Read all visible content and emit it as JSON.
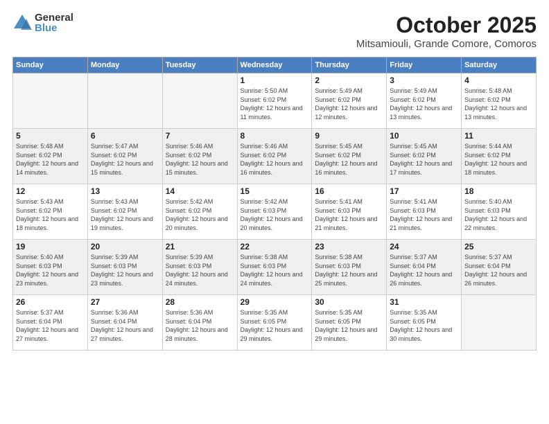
{
  "logo": {
    "general": "General",
    "blue": "Blue"
  },
  "title": "October 2025",
  "subtitle": "Mitsamiouli, Grande Comore, Comoros",
  "days_of_week": [
    "Sunday",
    "Monday",
    "Tuesday",
    "Wednesday",
    "Thursday",
    "Friday",
    "Saturday"
  ],
  "weeks": [
    [
      {
        "day": "",
        "info": ""
      },
      {
        "day": "",
        "info": ""
      },
      {
        "day": "",
        "info": ""
      },
      {
        "day": "1",
        "info": "Sunrise: 5:50 AM\nSunset: 6:02 PM\nDaylight: 12 hours and 11 minutes."
      },
      {
        "day": "2",
        "info": "Sunrise: 5:49 AM\nSunset: 6:02 PM\nDaylight: 12 hours and 12 minutes."
      },
      {
        "day": "3",
        "info": "Sunrise: 5:49 AM\nSunset: 6:02 PM\nDaylight: 12 hours and 13 minutes."
      },
      {
        "day": "4",
        "info": "Sunrise: 5:48 AM\nSunset: 6:02 PM\nDaylight: 12 hours and 13 minutes."
      }
    ],
    [
      {
        "day": "5",
        "info": "Sunrise: 5:48 AM\nSunset: 6:02 PM\nDaylight: 12 hours and 14 minutes."
      },
      {
        "day": "6",
        "info": "Sunrise: 5:47 AM\nSunset: 6:02 PM\nDaylight: 12 hours and 15 minutes."
      },
      {
        "day": "7",
        "info": "Sunrise: 5:46 AM\nSunset: 6:02 PM\nDaylight: 12 hours and 15 minutes."
      },
      {
        "day": "8",
        "info": "Sunrise: 5:46 AM\nSunset: 6:02 PM\nDaylight: 12 hours and 16 minutes."
      },
      {
        "day": "9",
        "info": "Sunrise: 5:45 AM\nSunset: 6:02 PM\nDaylight: 12 hours and 16 minutes."
      },
      {
        "day": "10",
        "info": "Sunrise: 5:45 AM\nSunset: 6:02 PM\nDaylight: 12 hours and 17 minutes."
      },
      {
        "day": "11",
        "info": "Sunrise: 5:44 AM\nSunset: 6:02 PM\nDaylight: 12 hours and 18 minutes."
      }
    ],
    [
      {
        "day": "12",
        "info": "Sunrise: 5:43 AM\nSunset: 6:02 PM\nDaylight: 12 hours and 18 minutes."
      },
      {
        "day": "13",
        "info": "Sunrise: 5:43 AM\nSunset: 6:02 PM\nDaylight: 12 hours and 19 minutes."
      },
      {
        "day": "14",
        "info": "Sunrise: 5:42 AM\nSunset: 6:02 PM\nDaylight: 12 hours and 20 minutes."
      },
      {
        "day": "15",
        "info": "Sunrise: 5:42 AM\nSunset: 6:03 PM\nDaylight: 12 hours and 20 minutes."
      },
      {
        "day": "16",
        "info": "Sunrise: 5:41 AM\nSunset: 6:03 PM\nDaylight: 12 hours and 21 minutes."
      },
      {
        "day": "17",
        "info": "Sunrise: 5:41 AM\nSunset: 6:03 PM\nDaylight: 12 hours and 21 minutes."
      },
      {
        "day": "18",
        "info": "Sunrise: 5:40 AM\nSunset: 6:03 PM\nDaylight: 12 hours and 22 minutes."
      }
    ],
    [
      {
        "day": "19",
        "info": "Sunrise: 5:40 AM\nSunset: 6:03 PM\nDaylight: 12 hours and 23 minutes."
      },
      {
        "day": "20",
        "info": "Sunrise: 5:39 AM\nSunset: 6:03 PM\nDaylight: 12 hours and 23 minutes."
      },
      {
        "day": "21",
        "info": "Sunrise: 5:39 AM\nSunset: 6:03 PM\nDaylight: 12 hours and 24 minutes."
      },
      {
        "day": "22",
        "info": "Sunrise: 5:38 AM\nSunset: 6:03 PM\nDaylight: 12 hours and 24 minutes."
      },
      {
        "day": "23",
        "info": "Sunrise: 5:38 AM\nSunset: 6:03 PM\nDaylight: 12 hours and 25 minutes."
      },
      {
        "day": "24",
        "info": "Sunrise: 5:37 AM\nSunset: 6:04 PM\nDaylight: 12 hours and 26 minutes."
      },
      {
        "day": "25",
        "info": "Sunrise: 5:37 AM\nSunset: 6:04 PM\nDaylight: 12 hours and 26 minutes."
      }
    ],
    [
      {
        "day": "26",
        "info": "Sunrise: 5:37 AM\nSunset: 6:04 PM\nDaylight: 12 hours and 27 minutes."
      },
      {
        "day": "27",
        "info": "Sunrise: 5:36 AM\nSunset: 6:04 PM\nDaylight: 12 hours and 27 minutes."
      },
      {
        "day": "28",
        "info": "Sunrise: 5:36 AM\nSunset: 6:04 PM\nDaylight: 12 hours and 28 minutes."
      },
      {
        "day": "29",
        "info": "Sunrise: 5:35 AM\nSunset: 6:05 PM\nDaylight: 12 hours and 29 minutes."
      },
      {
        "day": "30",
        "info": "Sunrise: 5:35 AM\nSunset: 6:05 PM\nDaylight: 12 hours and 29 minutes."
      },
      {
        "day": "31",
        "info": "Sunrise: 5:35 AM\nSunset: 6:05 PM\nDaylight: 12 hours and 30 minutes."
      },
      {
        "day": "",
        "info": ""
      }
    ]
  ]
}
